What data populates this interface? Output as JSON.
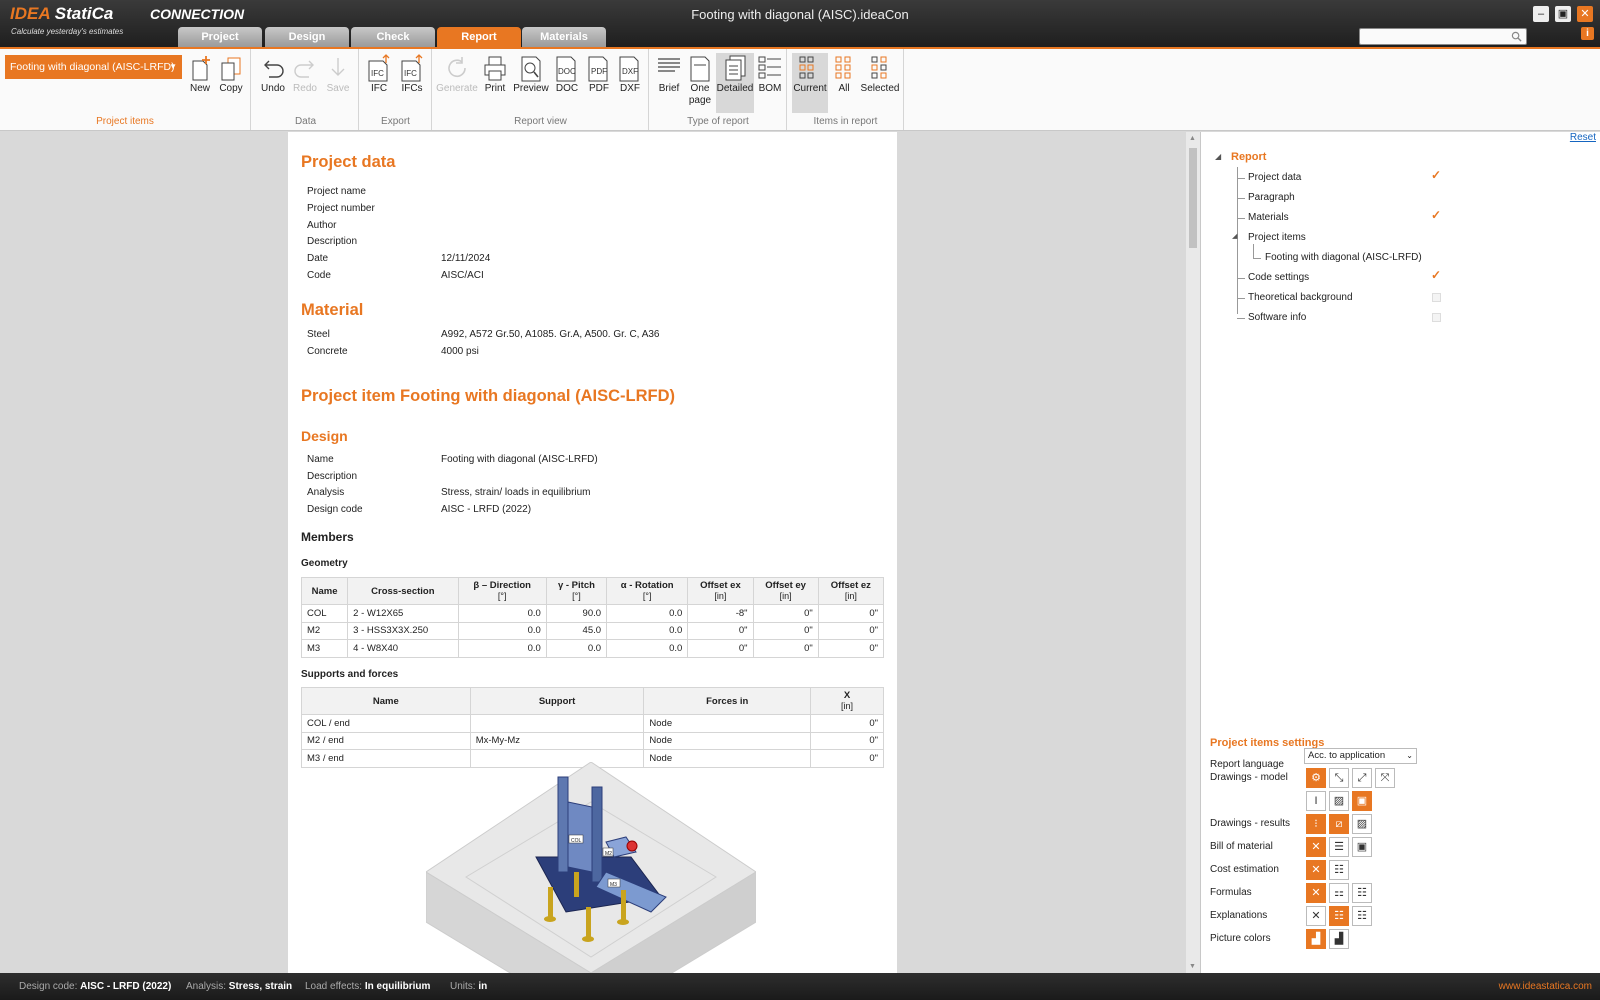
{
  "app": {
    "logo_idea": "IDEA",
    "logo_statica": "StatiCa",
    "product": "CONNECTION",
    "tagline": "Calculate yesterday's estimates",
    "window_title": "Footing with diagonal (AISC).ideaCon"
  },
  "tabs": [
    {
      "label": "Project",
      "active": false
    },
    {
      "label": "Design",
      "active": false
    },
    {
      "label": "Check",
      "active": false
    },
    {
      "label": "Report",
      "active": true
    },
    {
      "label": "Materials",
      "active": false
    }
  ],
  "search": {
    "placeholder": "",
    "icon": "search-icon"
  },
  "ribbon": {
    "project_items": {
      "selected": "Footing with diagonal (AISC-LRFD)",
      "new_label": "New",
      "copy_label": "Copy",
      "group_label": "Project items"
    },
    "data": {
      "undo": "Undo",
      "redo": "Redo",
      "save": "Save",
      "group_label": "Data"
    },
    "export": {
      "ifc": "IFC",
      "ifcs": "IFCs",
      "group_label": "Export"
    },
    "report_view": {
      "generate": "Generate",
      "print": "Print",
      "preview": "Preview",
      "doc": "DOC",
      "pdf": "PDF",
      "dxf": "DXF",
      "group_label": "Report view"
    },
    "type_of_report": {
      "brief": "Brief",
      "one_page_1": "One",
      "one_page_2": "page",
      "detailed": "Detailed",
      "bom": "BOM",
      "group_label": "Type of report",
      "selected": "Detailed"
    },
    "items_in_report": {
      "current": "Current",
      "all": "All",
      "selected_label": "Selected",
      "group_label": "Items in report",
      "selected": "Current"
    }
  },
  "report": {
    "project_data": {
      "title": "Project data",
      "rows": [
        {
          "k": "Project name",
          "v": ""
        },
        {
          "k": "Project number",
          "v": ""
        },
        {
          "k": "Author",
          "v": ""
        },
        {
          "k": "Description",
          "v": ""
        },
        {
          "k": "Date",
          "v": "12/11/2024"
        },
        {
          "k": "Code",
          "v": "AISC/ACI"
        }
      ]
    },
    "material": {
      "title": "Material",
      "rows": [
        {
          "k": "Steel",
          "v": "A992, A572 Gr.50, A1085. Gr.A, A500. Gr. C, A36"
        },
        {
          "k": "Concrete",
          "v": "4000 psi"
        }
      ]
    },
    "project_item_title": "Project item Footing with diagonal (AISC-LRFD)",
    "design": {
      "title": "Design",
      "rows": [
        {
          "k": "Name",
          "v": "Footing with diagonal (AISC-LRFD)"
        },
        {
          "k": "Description",
          "v": ""
        },
        {
          "k": "Analysis",
          "v": "Stress, strain/ loads in equilibrium"
        },
        {
          "k": "Design code",
          "v": "AISC - LRFD (2022)"
        }
      ]
    },
    "members_title": "Members",
    "geometry_title": "Geometry",
    "geometry_table": {
      "headers": [
        {
          "t": "Name",
          "u": ""
        },
        {
          "t": "Cross-section",
          "u": ""
        },
        {
          "t": "β – Direction",
          "u": "[°]"
        },
        {
          "t": "γ - Pitch",
          "u": "[°]"
        },
        {
          "t": "α - Rotation",
          "u": "[°]"
        },
        {
          "t": "Offset ex",
          "u": "[in]"
        },
        {
          "t": "Offset ey",
          "u": "[in]"
        },
        {
          "t": "Offset ez",
          "u": "[in]"
        }
      ],
      "rows": [
        [
          "COL",
          "2 - W12X65",
          "0.0",
          "90.0",
          "0.0",
          "-8\"",
          "0\"",
          "0\""
        ],
        [
          "M2",
          "3 - HSS3X3X.250",
          "0.0",
          "45.0",
          "0.0",
          "0\"",
          "0\"",
          "0\""
        ],
        [
          "M3",
          "4 - W8X40",
          "0.0",
          "0.0",
          "0.0",
          "0\"",
          "0\"",
          "0\""
        ]
      ]
    },
    "supports_title": "Supports and forces",
    "supports_table": {
      "headers": [
        {
          "t": "Name",
          "u": ""
        },
        {
          "t": "Support",
          "u": ""
        },
        {
          "t": "Forces in",
          "u": ""
        },
        {
          "t": "X",
          "u": "[in]"
        }
      ],
      "rows": [
        [
          "COL / end",
          "",
          "Node",
          "0\""
        ],
        [
          "M2 / end",
          "Mx-My-Mz",
          "Node",
          "0\""
        ],
        [
          "M3 / end",
          "",
          "Node",
          "0\""
        ]
      ]
    },
    "model_labels": {
      "col": "COL",
      "m2": "M2",
      "m3": "M3"
    }
  },
  "tree": {
    "reset": "Reset",
    "root": "Report",
    "items": [
      {
        "label": "Project data",
        "checked": true
      },
      {
        "label": "Paragraph",
        "checked": null
      },
      {
        "label": "Materials",
        "checked": true
      },
      {
        "label": "Project items",
        "checked": null
      },
      {
        "label": "Footing with diagonal (AISC-LRFD)",
        "checked": null
      },
      {
        "label": "Code settings",
        "checked": true
      },
      {
        "label": "Theoretical background",
        "checked": false
      },
      {
        "label": "Software info",
        "checked": false
      }
    ]
  },
  "settings": {
    "title": "Project items settings",
    "report_language_label": "Report language",
    "report_language_value": "Acc. to application",
    "drawings_model": "Drawings - model",
    "drawings_results": "Drawings - results",
    "bill_of_material": "Bill of material",
    "cost_estimation": "Cost estimation",
    "formulas": "Formulas",
    "explanations": "Explanations",
    "picture_colors": "Picture colors"
  },
  "status": {
    "design_code_label": "Design code:",
    "design_code": "AISC - LRFD (2022)",
    "analysis_label": "Analysis:",
    "analysis": "Stress, strain",
    "load_effects_label": "Load effects:",
    "load_effects": "In equilibrium",
    "units_label": "Units:",
    "units": "in",
    "website": "www.ideastatica.com"
  },
  "colors": {
    "accent": "#e87722",
    "titlebar": "#2a2a2a",
    "link": "#1565c0"
  }
}
